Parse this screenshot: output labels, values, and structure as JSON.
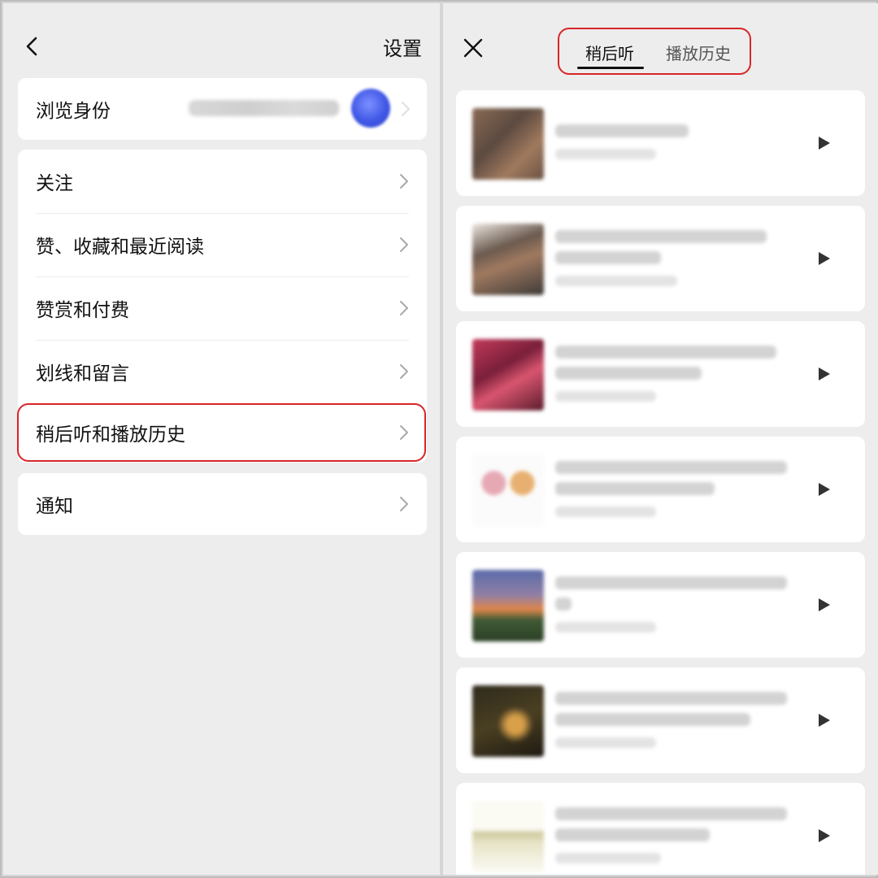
{
  "settings": {
    "title": "设置",
    "identity_label": "浏览身份",
    "menu": [
      {
        "label": "关注"
      },
      {
        "label": "赞、收藏和最近阅读"
      },
      {
        "label": "赞赏和付费"
      },
      {
        "label": "划线和留言"
      },
      {
        "label": "稍后听和播放历史"
      }
    ],
    "notify_label": "通知"
  },
  "listen": {
    "tabs": [
      {
        "label": "稍后听",
        "active": true
      },
      {
        "label": "播放历史",
        "active": false
      }
    ]
  },
  "colors": {
    "highlight": "#d92527",
    "avatar": "#3f57e6",
    "background": "#ededed"
  }
}
